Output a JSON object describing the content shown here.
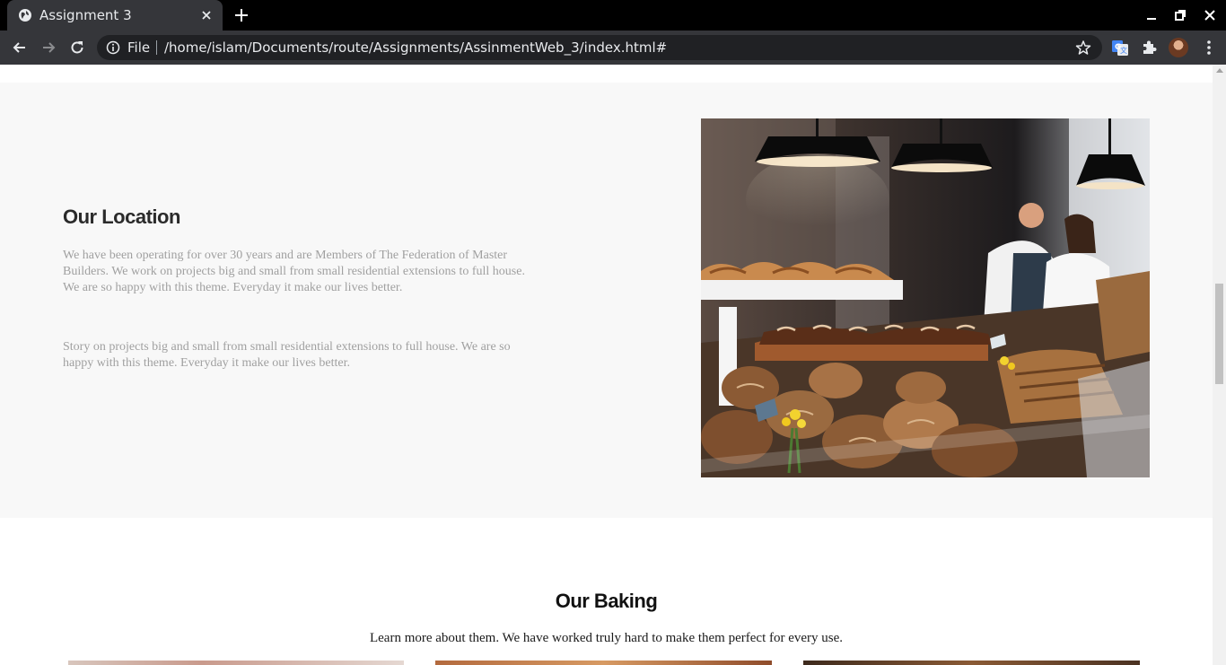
{
  "browser": {
    "tab_title": "Assignment 3",
    "omnibox_file_label": "File",
    "url": "/home/islam/Documents/route/Assignments/AssinmentWeb_3/index.html#"
  },
  "location": {
    "title": "Our Location",
    "paragraph_1_lines": [
      "We have been operating for over 30 years and are Members of The Federation of Master",
      "Builders. We work on projects big and small from small residential extensions to full house.",
      "We are so happy with this theme. Everyday it make our lives better."
    ],
    "paragraph_2_lines": [
      "Story on projects big and small from small residential extensions to full house. We are so",
      "happy with this theme. Everyday it make our lives better."
    ]
  },
  "baking": {
    "title": "Our Baking",
    "subtitle": "Learn more about them. We have worked truly hard to make them perfect for every use."
  },
  "icons": {
    "favicon": "globe-icon",
    "tab_close": "close-icon",
    "new_tab": "plus-icon",
    "back": "arrow-left-icon",
    "forward": "arrow-right-icon",
    "reload": "reload-icon",
    "site_info": "info-icon",
    "bookmark": "star-icon",
    "translate": "translate-icon",
    "extensions": "puzzle-icon",
    "menu": "kebab-icon"
  },
  "colors": {
    "chrome_dark": "#35363a",
    "titlebar": "#000000",
    "section_bg": "#f8f8f8",
    "body_text_muted": "#a0a0a0",
    "heading": "#2b2b2b"
  }
}
